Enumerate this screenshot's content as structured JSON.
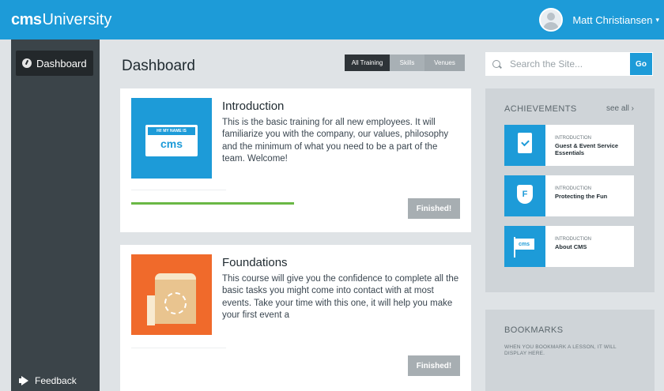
{
  "topbar": {
    "brand_bold": "cms",
    "brand_light": "University",
    "user_name": "Matt Christiansen",
    "caret": "▾",
    "accent_color": "#1d9bd8"
  },
  "sidebar": {
    "items": [
      {
        "label": "Dashboard",
        "icon": "info-icon",
        "active": true
      }
    ],
    "feedback_label": "Feedback"
  },
  "main": {
    "title": "Dashboard",
    "tabs": [
      {
        "label": "All Training",
        "active": true
      },
      {
        "label": "Skills",
        "active": false
      },
      {
        "label": "Venues",
        "active": false
      }
    ],
    "search": {
      "placeholder": "Search the Site...",
      "button_label": "Go"
    },
    "courses": [
      {
        "title": "Introduction",
        "description": "This is the basic training for all new employees. It will familiarize you with the company, our values, philosophy and the minimum of what you need to be a part of the team. Welcome!",
        "tag_top": "HI! MY NAME IS",
        "tag_mark": "cms",
        "progress": 1.0,
        "status_label": "Finished!",
        "thumb_color": "#1d9bd8"
      },
      {
        "title": "Foundations",
        "description": "This course will give you the confidence to complete all the basic tasks you might come into contact with at most events. Take your time with this one, it will help you make your first event a",
        "progress": 0,
        "status_label": "Finished!",
        "thumb_color": "#f06a2b"
      }
    ]
  },
  "achievements": {
    "title": "ACHIEVEMENTS",
    "see_all": "see all ›",
    "items": [
      {
        "kicker": "INTRODUCTION",
        "name": "Guest & Event Service Essentials",
        "icon": "clipboard-check-icon"
      },
      {
        "kicker": "INTRODUCTION",
        "name": "Protecting the Fun",
        "icon": "shield-icon",
        "icon_text": "F"
      },
      {
        "kicker": "INTRODUCTION",
        "name": "About CMS",
        "icon": "flag-icon",
        "icon_text": "cms"
      }
    ]
  },
  "bookmarks": {
    "title": "BOOKMARKS",
    "empty_text": "WHEN YOU BOOKMARK A LESSON, IT WILL DISPLAY HERE."
  }
}
